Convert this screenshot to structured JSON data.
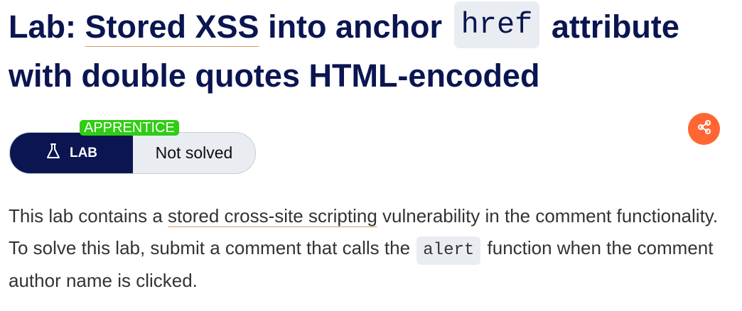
{
  "title": {
    "prefix": "Lab: ",
    "link": "Stored XSS",
    "middle": " into anchor ",
    "code": "href",
    "suffix": " attribute with double quotes HTML-encoded"
  },
  "badge": {
    "level": "APPRENTICE",
    "type": "LAB",
    "status": "Not solved"
  },
  "share": {
    "icon": "share-icon"
  },
  "description": {
    "part1": "This lab contains a ",
    "link": "stored cross-site scripting",
    "part2": " vulnerability in the comment functionality. To solve this lab, submit a comment that calls the ",
    "code": "alert",
    "part3": " function when the comment author name is clicked."
  },
  "colors": {
    "navy": "#0a1551",
    "apprentice_green": "#2fcd13",
    "share_orange": "#ff6633",
    "pill_grey": "#e9edf2",
    "link_underline": "#d59b6b"
  }
}
